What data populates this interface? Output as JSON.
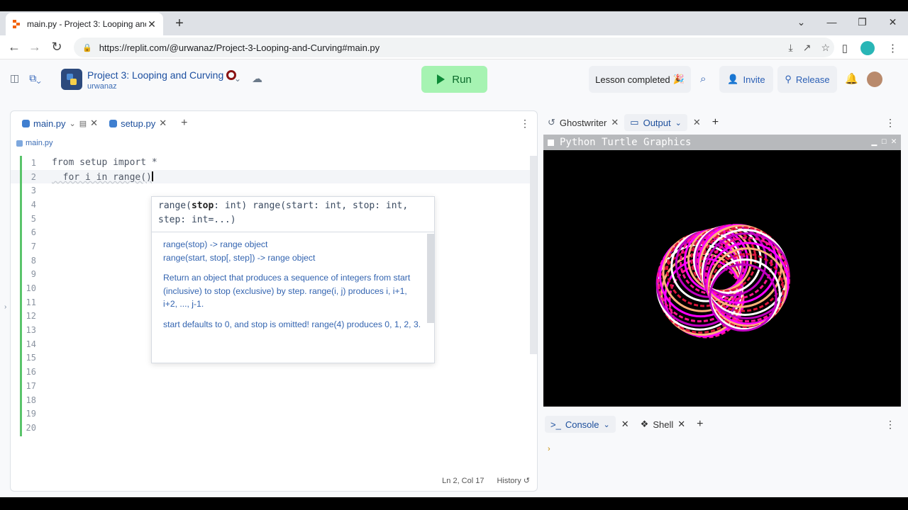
{
  "browser": {
    "tab_title": "main.py - Project 3: Looping and",
    "url": "https://replit.com/@urwanaz/Project-3-Looping-and-Curving#main.py"
  },
  "header": {
    "project_title": "Project 3: Looping and Curving",
    "username": "urwanaz",
    "run_label": "Run",
    "lesson_label": "Lesson completed",
    "invite_label": "Invite",
    "release_label": "Release"
  },
  "editor": {
    "tabs": [
      {
        "label": "main.py"
      },
      {
        "label": "setup.py"
      }
    ],
    "breadcrumb": "main.py",
    "lines": [
      {
        "n": "1",
        "text": "from setup import *"
      },
      {
        "n": "2",
        "text": "  for i in range()"
      },
      {
        "n": "3",
        "text": ""
      },
      {
        "n": "4",
        "text": ""
      },
      {
        "n": "5",
        "text": ""
      },
      {
        "n": "6",
        "text": ""
      },
      {
        "n": "7",
        "text": ""
      },
      {
        "n": "8",
        "text": ""
      },
      {
        "n": "9",
        "text": ""
      },
      {
        "n": "10",
        "text": ""
      },
      {
        "n": "11",
        "text": ""
      },
      {
        "n": "12",
        "text": ""
      },
      {
        "n": "13",
        "text": ""
      },
      {
        "n": "14",
        "text": ""
      },
      {
        "n": "15",
        "text": ""
      },
      {
        "n": "16",
        "text": ""
      },
      {
        "n": "17",
        "text": ""
      },
      {
        "n": "18",
        "text": ""
      },
      {
        "n": "19",
        "text": ""
      },
      {
        "n": "20",
        "text": ""
      }
    ],
    "cursor_position": "Ln 2, Col 17",
    "history_label": "History"
  },
  "autocomplete": {
    "sig_a": "range(",
    "sig_b": "stop",
    "sig_c": ": int) range(start: int, stop: int,",
    "sig_d": "step: int=...)",
    "doc_line1": "range(stop) -> range object",
    "doc_line2": "range(start, stop[, step]) -> range object",
    "doc_para1": "Return an object that produces a sequence of integers from start (inclusive) to stop (exclusive) by step.  range(i, j) produces i, i+1, i+2, ..., j-1.",
    "doc_para2": "start defaults to 0, and stop is omitted!  range(4) produces 0, 1, 2, 3."
  },
  "right_pane": {
    "tabs": [
      {
        "label": "Ghostwriter"
      },
      {
        "label": "Output"
      }
    ],
    "turtle_title": "Python Turtle Graphics"
  },
  "console": {
    "tabs": [
      {
        "label": "Console"
      },
      {
        "label": "Shell"
      }
    ],
    "prompt": "›"
  },
  "colors": {
    "run_bg": "#a6f3b2",
    "accent": "#1d4f9c",
    "turtle_colors": [
      "#ff1493",
      "#ff00ff",
      "#ffb07a",
      "#dc143c",
      "#ffffff",
      "#c000c0"
    ]
  }
}
